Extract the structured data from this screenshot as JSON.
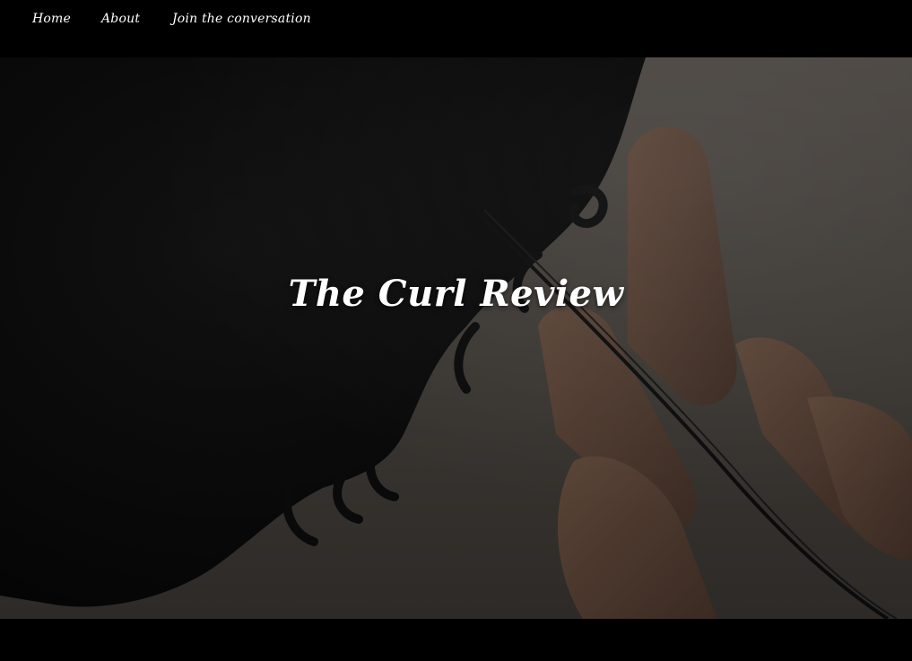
{
  "nav": {
    "items": [
      {
        "label": "Home"
      },
      {
        "label": "About"
      },
      {
        "label": "Join the conversation"
      }
    ]
  },
  "hero": {
    "title": "The Curl Review",
    "image_subject": "curly-hair-and-fingers-photo"
  },
  "colors": {
    "nav_background": "#000000",
    "nav_text": "#ffffff",
    "hero_tint": "#3b3733",
    "title_text": "#ffffff"
  }
}
